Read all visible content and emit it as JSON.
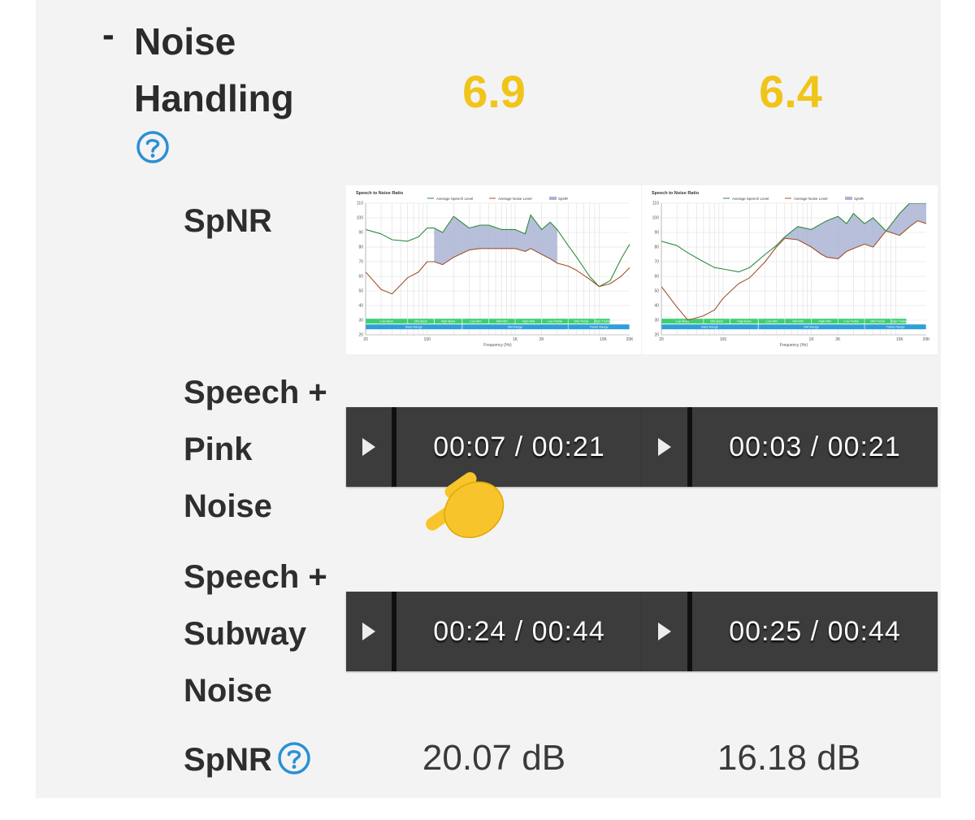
{
  "section": {
    "collapse_symbol": "-",
    "title_line1": "Noise",
    "title_line2": "Handling",
    "help_icon": "help-circle-icon",
    "scores": [
      "6.9",
      "6.4"
    ],
    "score_color": "#f0c419",
    "accent_color": "#2a8fd6"
  },
  "spnr_graph_label": "SpNR",
  "charts": [
    {
      "title": "Speech to Noise Ratio",
      "legend": [
        "Average Speech Level",
        "Average Noise Level",
        "SpNR"
      ],
      "y_ticks": [
        "110",
        "100",
        "90",
        "80",
        "70",
        "60",
        "50",
        "40",
        "30",
        "20"
      ],
      "x_ticks": [
        "20",
        "100",
        "1K",
        "2K",
        "10K",
        "20K"
      ],
      "xlabel": "Frequency (Hz)",
      "bands": [
        "Low-Bass",
        "Mid-Bass",
        "High-Bass",
        "Low-Mid",
        "Mid-Mid",
        "High-Mid",
        "Low-Treble",
        "Mid-Treble",
        "High-Treble"
      ],
      "ranges": [
        "Bass Range",
        "Mid Range",
        "Treble Range"
      ]
    },
    {
      "title": "Speech to Noise Ratio",
      "legend": [
        "Average Speech Level",
        "Average Noise Level",
        "SpNR"
      ],
      "y_ticks": [
        "110",
        "100",
        "90",
        "80",
        "70",
        "60",
        "50",
        "40",
        "30",
        "20"
      ],
      "x_ticks": [
        "20",
        "100",
        "1K",
        "2K",
        "10K",
        "20K"
      ],
      "xlabel": "Frequency (Hz)",
      "bands": [
        "Low-Bass",
        "Mid-Bass",
        "High-Bass",
        "Low-Mid",
        "Mid-Mid",
        "High-Mid",
        "Low-Treble",
        "Mid-Treble",
        "High-Treble"
      ],
      "ranges": [
        "Bass Range",
        "Mid Range",
        "Treble Range"
      ]
    }
  ],
  "chart_data": [
    {
      "type": "line",
      "title": "Speech to Noise Ratio",
      "xlabel": "Frequency (Hz)",
      "ylabel": "",
      "x_scale": "log",
      "xlim": [
        20,
        20000
      ],
      "ylim": [
        20,
        110
      ],
      "series": [
        {
          "name": "Average Speech Level",
          "color": "#2e8b3e",
          "x": [
            20,
            30,
            40,
            60,
            80,
            100,
            120,
            150,
            200,
            300,
            400,
            500,
            700,
            1000,
            1300,
            1500,
            2000,
            2500,
            3000,
            4000,
            5000,
            7000,
            9000,
            12000,
            16000,
            20000
          ],
          "y": [
            92,
            89,
            85,
            84,
            87,
            93,
            93,
            90,
            101,
            93,
            95,
            95,
            92,
            92,
            89,
            102,
            92,
            97,
            92,
            81,
            73,
            60,
            53,
            57,
            72,
            82
          ]
        },
        {
          "name": "Average Noise Level",
          "color": "#a0522d",
          "x": [
            20,
            30,
            40,
            60,
            80,
            100,
            120,
            150,
            200,
            300,
            400,
            500,
            700,
            1000,
            1300,
            1500,
            2000,
            2500,
            3000,
            4000,
            5000,
            7000,
            9000,
            12000,
            16000,
            20000
          ],
          "y": [
            63,
            51,
            48,
            59,
            63,
            70,
            70,
            68,
            73,
            78,
            79,
            79,
            79,
            79,
            77,
            79,
            75,
            72,
            69,
            67,
            64,
            58,
            53,
            55,
            60,
            66
          ]
        }
      ],
      "spnr_fill_range": [
        120,
        3000
      ]
    },
    {
      "type": "line",
      "title": "Speech to Noise Ratio",
      "xlabel": "Frequency (Hz)",
      "ylabel": "",
      "x_scale": "log",
      "xlim": [
        20,
        20000
      ],
      "ylim": [
        20,
        110
      ],
      "series": [
        {
          "name": "Average Speech Level",
          "color": "#2e8b3e",
          "x": [
            20,
            30,
            40,
            60,
            80,
            100,
            150,
            200,
            300,
            400,
            500,
            700,
            1000,
            1300,
            1500,
            2000,
            2500,
            3000,
            4000,
            5000,
            7000,
            10000,
            13000,
            16000,
            20000
          ],
          "y": [
            84,
            81,
            76,
            70,
            66,
            65,
            63,
            66,
            75,
            81,
            87,
            94,
            92,
            96,
            98,
            101,
            96,
            103,
            96,
            100,
            91,
            103,
            111,
            118,
            115
          ]
        },
        {
          "name": "Average Noise Level",
          "color": "#a0522d",
          "x": [
            20,
            30,
            40,
            60,
            80,
            100,
            150,
            200,
            300,
            400,
            500,
            700,
            1000,
            1300,
            1500,
            2000,
            2500,
            3000,
            4000,
            5000,
            7000,
            10000,
            13000,
            16000,
            20000
          ],
          "y": [
            53,
            39,
            30,
            33,
            37,
            45,
            55,
            59,
            70,
            80,
            86,
            85,
            80,
            75,
            73,
            72,
            77,
            79,
            82,
            80,
            91,
            88,
            94,
            98,
            96
          ]
        }
      ],
      "spnr_fill_range": [
        500,
        20000
      ]
    }
  ],
  "rows": [
    {
      "label_lines": [
        "Speech +",
        "Pink",
        "Noise"
      ],
      "players": [
        {
          "time": "00:07 / 00:21"
        },
        {
          "time": "00:03 / 00:21"
        }
      ]
    },
    {
      "label_lines": [
        "Speech +",
        "Subway",
        "Noise"
      ],
      "players": [
        {
          "time": "00:24 / 00:44"
        },
        {
          "time": "00:25 / 00:44"
        }
      ]
    }
  ],
  "spnr_value_row": {
    "label": "SpNR",
    "help_icon": "help-circle-icon",
    "values": [
      "20.07 dB",
      "16.18 dB"
    ]
  },
  "overlay": {
    "icon": "pointing-hand-emoji-icon"
  }
}
